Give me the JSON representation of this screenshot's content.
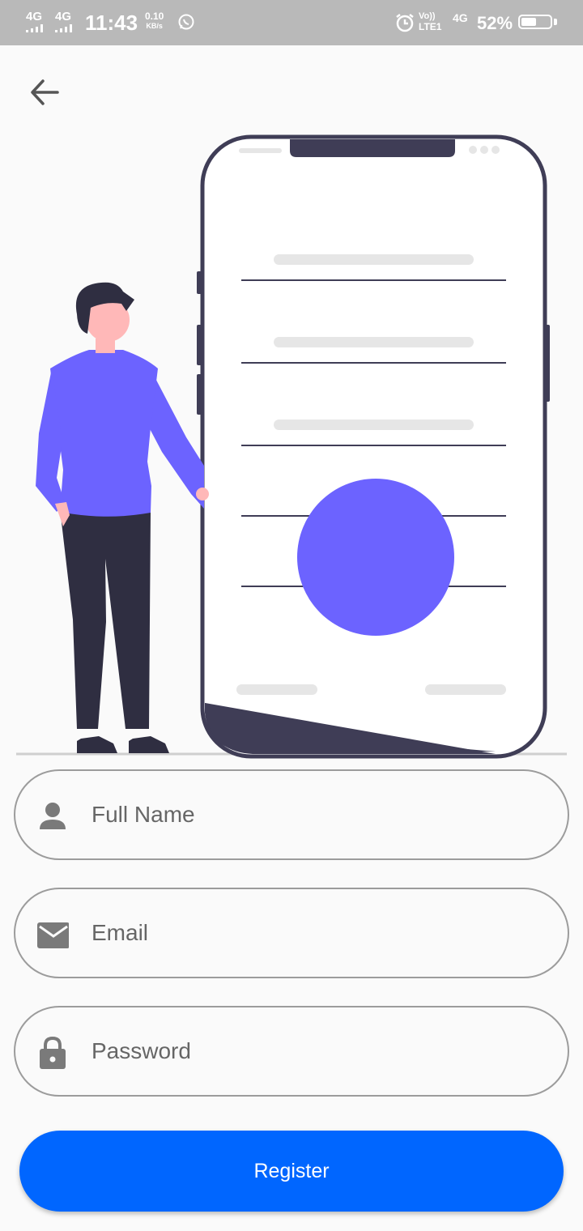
{
  "status_bar": {
    "network1": "4G",
    "network2": "4G",
    "time": "11:43",
    "speed_value": "0.10",
    "speed_unit": "KB/s",
    "volte_top": "Vo))",
    "volte_bottom": "LTE1",
    "network3": "4G",
    "battery_percent": "52%",
    "battery_level": 0.52
  },
  "form": {
    "full_name": {
      "placeholder": "Full Name",
      "value": ""
    },
    "email": {
      "placeholder": "Email",
      "value": ""
    },
    "password": {
      "placeholder": "Password",
      "value": ""
    },
    "register_label": "Register"
  },
  "colors": {
    "accent": "#0066ff",
    "illustration_purple": "#6c63ff",
    "illustration_dark": "#3f3d56",
    "status_bar_bg": "#b9b9b9"
  },
  "icons": {
    "back": "arrow-left-icon",
    "full_name": "person-icon",
    "email": "envelope-icon",
    "password": "lock-icon"
  }
}
